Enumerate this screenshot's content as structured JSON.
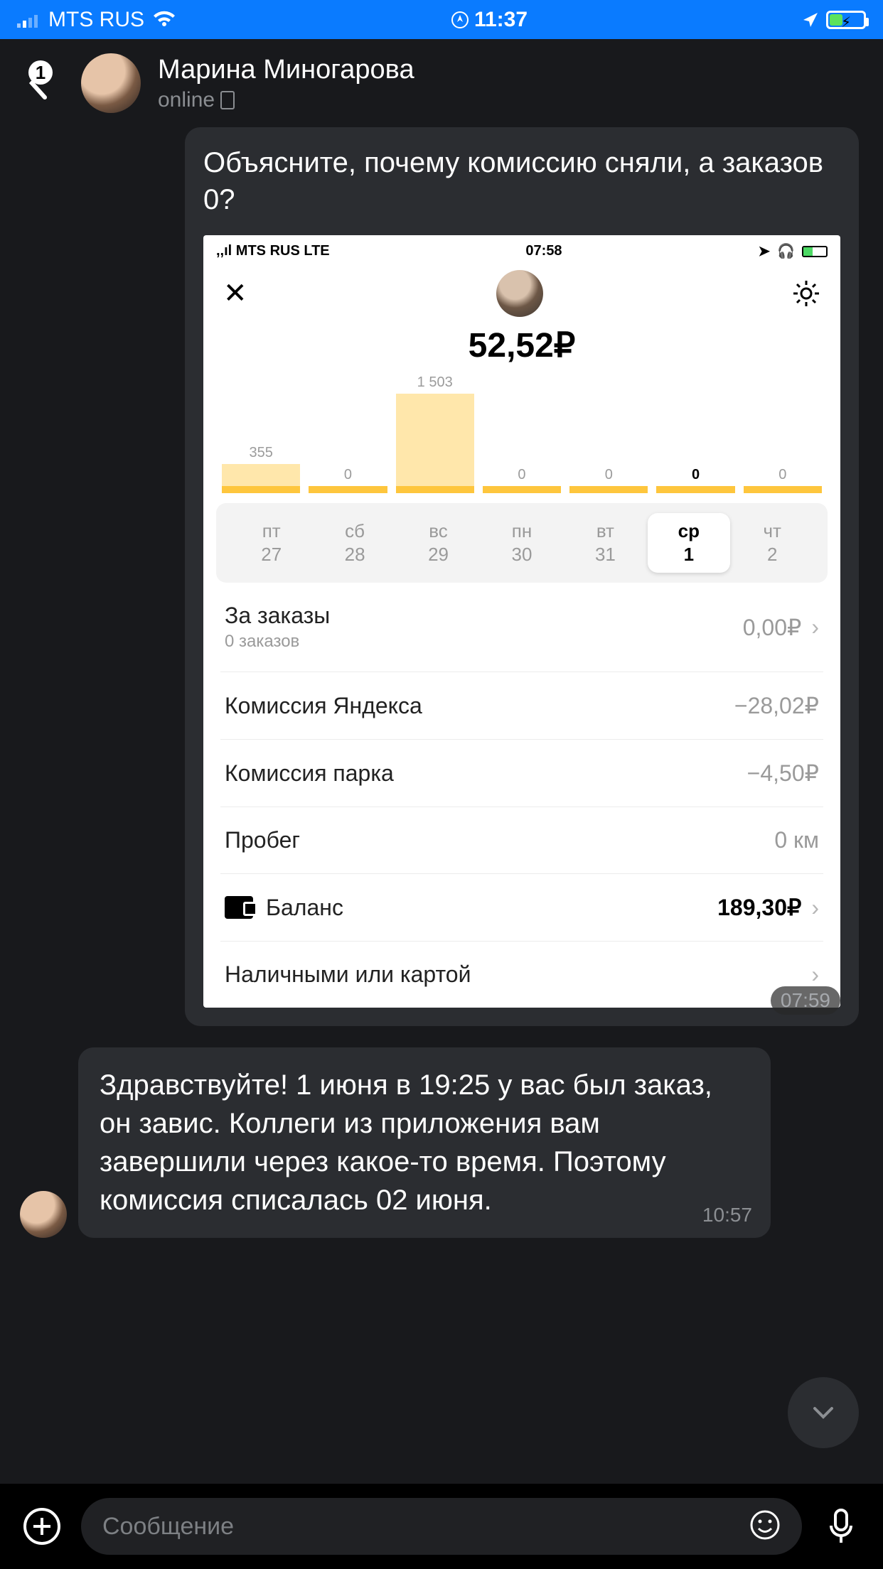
{
  "outer_status": {
    "carrier": "MTS RUS",
    "time": "11:37"
  },
  "chat_header": {
    "back_badge": "1",
    "name": "Марина Миногарова",
    "status": "online"
  },
  "message1": {
    "text": "Объясните, почему комиссию сняли, а заказов 0?",
    "time": "07:59"
  },
  "inner": {
    "status": {
      "carrier": "MTS RUS  LTE",
      "time": "07:58"
    },
    "amount_cut": "52,52₽",
    "days": [
      {
        "dow": "пт",
        "num": "27"
      },
      {
        "dow": "сб",
        "num": "28"
      },
      {
        "dow": "вс",
        "num": "29"
      },
      {
        "dow": "пн",
        "num": "30"
      },
      {
        "dow": "вт",
        "num": "31"
      },
      {
        "dow": "ср",
        "num": "1"
      },
      {
        "dow": "чт",
        "num": "2"
      }
    ],
    "selected_day_index": 5,
    "rows": {
      "orders_title": "За заказы",
      "orders_sub": "0 заказов",
      "orders_val": "0,00₽",
      "yandex_title": "Комиссия Яндекса",
      "yandex_val": "−28,02₽",
      "park_title": "Комиссия парка",
      "park_val": "−4,50₽",
      "mileage_title": "Пробег",
      "mileage_val": "0 км",
      "balance_title": "Баланс",
      "balance_val": "189,30₽",
      "payment_title": "Наличными или картой"
    }
  },
  "chart_data": {
    "type": "bar",
    "categories": [
      "пт 27",
      "сб 28",
      "вс 29",
      "пн 30",
      "вт 31",
      "ср 1",
      "чт 2"
    ],
    "values": [
      355,
      0,
      1503,
      0,
      0,
      0,
      0
    ],
    "labels": [
      "355",
      "0",
      "1 503",
      "0",
      "0",
      "0",
      "0"
    ],
    "highlight_index": 5,
    "title": "",
    "xlabel": "",
    "ylabel": "",
    "ylim": [
      0,
      1503
    ]
  },
  "message2": {
    "text": "Здравствуйте! 1 июня в 19:25 у вас был заказ, он завис. Коллеги из приложения вам завершили через какое-то время. Поэтому комиссия списалась 02 июня.",
    "time": "10:57"
  },
  "input": {
    "placeholder": "Сообщение"
  }
}
